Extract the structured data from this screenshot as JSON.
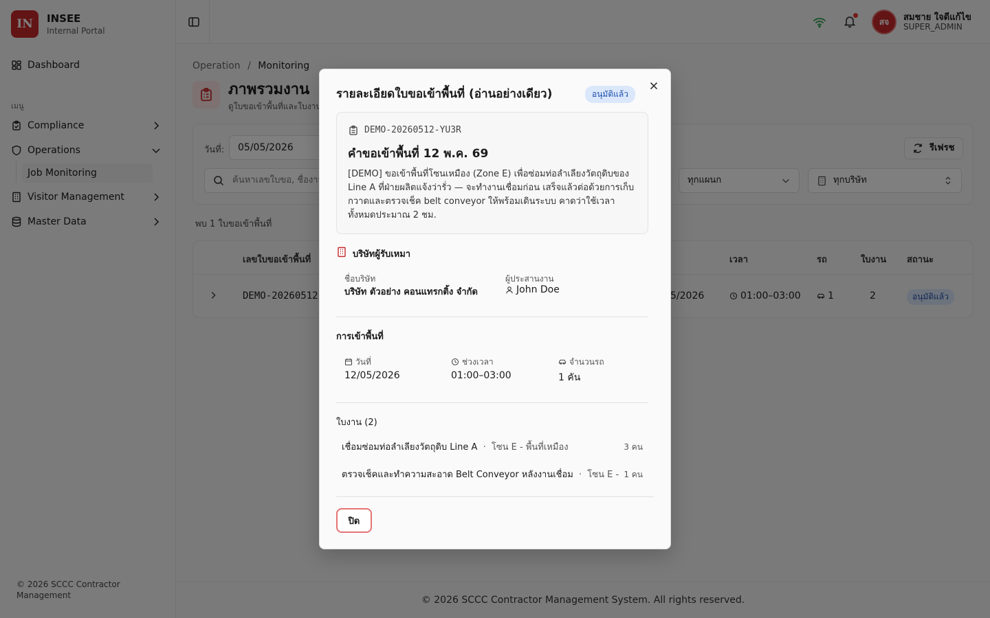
{
  "brand": {
    "logo": "IN",
    "name": "INSEE",
    "subtitle": "Internal Portal"
  },
  "sidebar": {
    "dashboard": "Dashboard",
    "section_label": "เมนู",
    "items": [
      {
        "label": "Compliance",
        "icon": "clipboard-check-icon"
      },
      {
        "label": "Operations",
        "icon": "shield-icon"
      },
      {
        "label": "Visitor Management",
        "icon": "building-icon"
      },
      {
        "label": "Master Data",
        "icon": "database-icon"
      }
    ],
    "sub_item": "Job Monitoring",
    "footer": "© 2026 SCCC Contractor Management"
  },
  "header": {
    "user_initials": "สจ",
    "user_name": "สมชาย ใจดีแก้ไข",
    "user_role": "SUPER_ADMIN"
  },
  "page": {
    "breadcrumb_root": "Operation",
    "breadcrumb_sep": "/",
    "breadcrumb_current": "Monitoring",
    "title": "ภาพรวมงาน",
    "desc": "ดูใบขอเข้าพื้นที่และใบงาน",
    "date_label": "วันที่:",
    "date_value": "05/05/2026",
    "search_placeholder": "ค้นหาเลขใบขอ, ชื่องาน,",
    "refresh": "รีเฟรช",
    "dept_select": "ทุกแผนก",
    "company_select": "ทุกบริษัท",
    "found_text": "พบ 1 ใบขอเข้าพื้นที่"
  },
  "table": {
    "headers": {
      "id": "เลขใบขอเข้าพื้นที่",
      "time": "เวลา",
      "car": "รถ",
      "jobs": "ใบงาน",
      "status": "สถานะ"
    },
    "row": {
      "id": "DEMO-20260512",
      "date_tail": "5/2026",
      "time": "01:00–03:00",
      "cars": "1",
      "jobs": "2",
      "status": "อนุมัติแล้ว"
    }
  },
  "footer": "© 2026 SCCC Contractor Management System. All rights reserved.",
  "modal": {
    "title": "รายละเอียดใบขอเข้าพื้นที่ (อ่านอย่างเดียว)",
    "status": "อนุมัติแล้ว",
    "request_id": "DEMO-20260512-YU3R",
    "request_title": "คำขอเข้าพื้นที่ 12 พ.ค. 69",
    "request_desc": "[DEMO] ขอเข้าพื้นที่โซนเหมือง (Zone E) เพื่อซ่อมท่อลำเลียงวัตถุดิบของ Line A ที่ฝ่ายผลิตแจ้งว่ารั่ว — จะทำงานเชื่อมก่อน เสร็จแล้วต่อด้วยการเก็บกวาดและตรวจเช็ค belt conveyor ให้พร้อมเดินระบบ คาดว่าใช้เวลาทั้งหมดประมาณ 2 ชม.",
    "contractor_section": "บริษัทผู้รับเหมา",
    "company_label": "ชื่อบริษัท",
    "company_value": "บริษัท ตัวอย่าง คอนแทรกติ้ง จำกัด",
    "coordinator_label": "ผู้ประสานงาน",
    "coordinator_value": "John Doe",
    "access_section": "การเข้าพื้นที่",
    "date_label": "วันที่",
    "date_value": "12/05/2026",
    "time_label": "ช่วงเวลา",
    "time_value": "01:00–03:00",
    "cars_label": "จำนวนรถ",
    "cars_value": "1 คัน",
    "jobs_section": "ใบงาน (2)",
    "jobs": [
      {
        "name": "เชื่อมซ่อมท่อลำเลียงวัตถุดิบ Line A",
        "sep": "·",
        "location": "โซน E - พื้นที่เหมือง",
        "count": "3 คน"
      },
      {
        "name": "ตรวจเช็คและทำความสะอาด Belt Conveyor หลังงานเชื่อม",
        "sep": "·",
        "location": "โซน E - ...",
        "count": "1 คน"
      }
    ],
    "close_button": "ปิด"
  }
}
